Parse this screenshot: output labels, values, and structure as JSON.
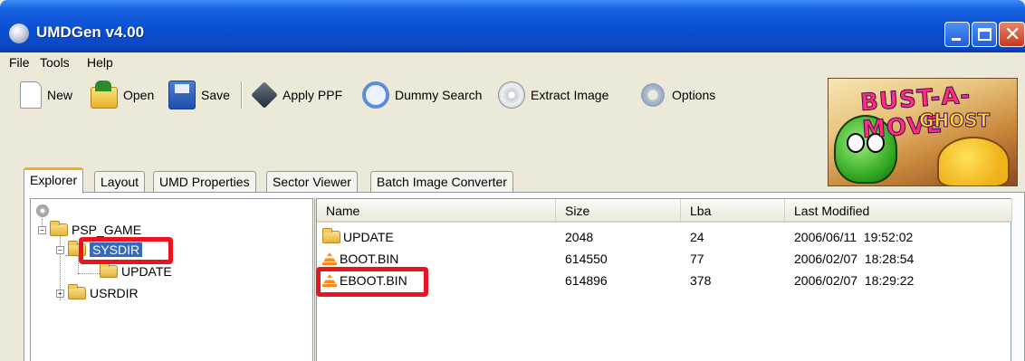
{
  "window": {
    "title": "UMDGen v4.00",
    "close_glyph": "✕"
  },
  "menu": {
    "items": [
      "File",
      "Tools",
      "Help"
    ]
  },
  "toolbar": {
    "buttons": [
      {
        "label": "New",
        "icon": "new-file-icon"
      },
      {
        "label": "Open",
        "icon": "open-folder-icon"
      },
      {
        "label": "Save",
        "icon": "floppy-save-icon"
      },
      {
        "label": "Apply PPF",
        "icon": "cube-icon"
      },
      {
        "label": "Dummy Search",
        "icon": "magnifier-icon"
      },
      {
        "label": "Extract Image",
        "icon": "disc-icon"
      },
      {
        "label": "Options",
        "icon": "gear-icon"
      }
    ]
  },
  "banner": {
    "title": "BUST-A-MOVE",
    "subtitle": "GHOST"
  },
  "tabs": {
    "items": [
      "Explorer",
      "Layout",
      "UMD Properties",
      "Sector Viewer",
      "Batch Image Converter"
    ],
    "active": "Explorer"
  },
  "tree": {
    "nodes": [
      {
        "label": "PSP_GAME",
        "expander": "−"
      },
      {
        "label": "SYSDIR",
        "expander": "−",
        "selected": true
      },
      {
        "label": "UPDATE"
      },
      {
        "label": "USRDIR",
        "expander": "+"
      }
    ]
  },
  "list": {
    "columns": [
      "Name",
      "Size",
      "Lba",
      "Last Modified"
    ],
    "rows": [
      {
        "name": "UPDATE",
        "type": "folder",
        "size": "2048",
        "lba": "24",
        "modified": "2006/06/11  19:52:02"
      },
      {
        "name": "BOOT.BIN",
        "type": "file",
        "size": "614550",
        "lba": "77",
        "modified": "2006/02/07  18:28:54"
      },
      {
        "name": "EBOOT.BIN",
        "type": "file",
        "size": "614896",
        "lba": "378",
        "modified": "2006/02/07  18:29:22"
      }
    ]
  },
  "colors": {
    "title_bar": "#0a4fd3",
    "selection": "#316ac5",
    "highlight_box": "#e8151e",
    "active_tab_accent": "#f9b020"
  }
}
